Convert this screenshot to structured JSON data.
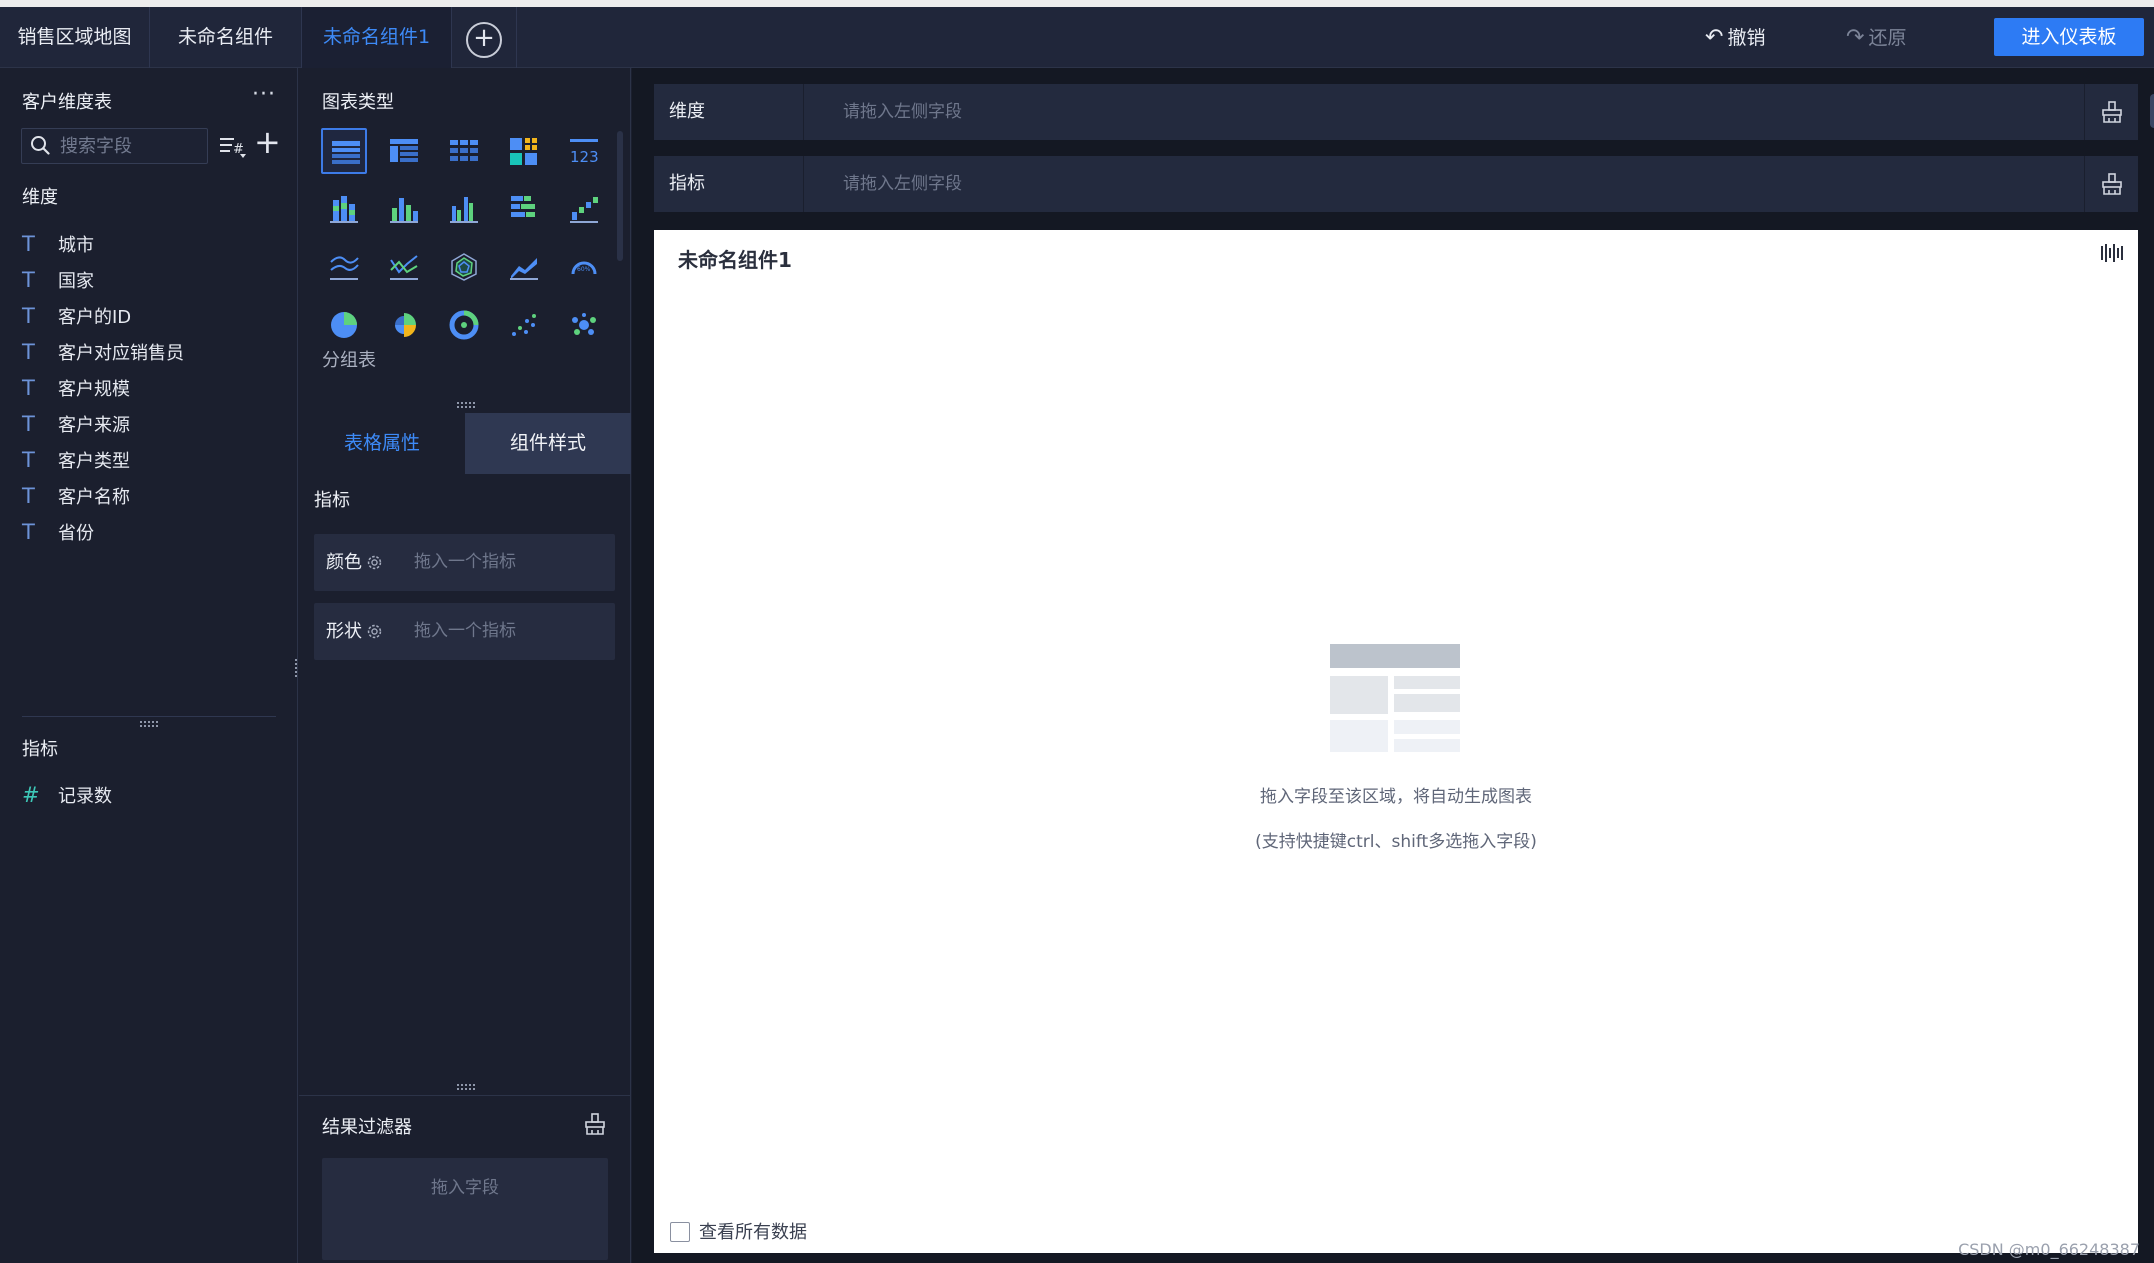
{
  "tabs": [
    {
      "label": "销售区域地图"
    },
    {
      "label": "未命名组件"
    },
    {
      "label": "未命名组件1"
    }
  ],
  "toolbar": {
    "undo_label": "撤销",
    "redo_label": "还原",
    "enter_dashboard_label": "进入仪表板"
  },
  "left_panel": {
    "table_title": "客户维度表",
    "more_glyph": "···",
    "search_placeholder": "搜索字段",
    "dimension_label": "维度",
    "dimensions": [
      "城市",
      "国家",
      "客户的ID",
      "客户对应销售员",
      "客户规模",
      "客户来源",
      "客户类型",
      "客户名称",
      "省份"
    ],
    "metric_label": "指标",
    "metrics": [
      "记录数"
    ]
  },
  "middle_panel": {
    "chart_type_title": "图表类型",
    "selected_chart_name": "分组表",
    "chart_type_icons": [
      "grouped-table-icon",
      "cross-table-icon",
      "detail-table-icon",
      "heatmap-table-icon",
      "kpi-number-icon",
      "stacked-bar-icon",
      "column-chart-icon",
      "grouped-column-icon",
      "horizontal-bar-icon",
      "waterfall-icon",
      "line-chart-icon",
      "combo-line-icon",
      "radar-chart-icon",
      "area-chart-icon",
      "gauge-icon",
      "pie-chart-icon",
      "rose-pie-icon",
      "ring-chart-icon",
      "scatter-icon",
      "bubble-icon"
    ],
    "prop_tabs": [
      "表格属性",
      "组件样式"
    ],
    "metric_label": "指标",
    "color_label": "颜色",
    "shape_label": "形状",
    "drop_metric_placeholder": "拖入一个指标",
    "result_filter_title": "结果过滤器",
    "drop_field_placeholder": "拖入字段"
  },
  "right_panel": {
    "dimension_shelf_label": "维度",
    "metric_shelf_label": "指标",
    "shelf_placeholder": "请拖入左侧字段",
    "component_title": "未命名组件1",
    "hint_line1": "拖入字段至该区域，将自动生成图表",
    "hint_line2": "(支持快捷键ctrl、shift多选拖入字段)",
    "view_all_label": "查看所有数据",
    "view_all_checked": false,
    "watermark": "CSDN @m0_66248387"
  },
  "colors": {
    "accent": "#2d7bf4",
    "active_tab_text": "#3d8af7",
    "background": "#1b1f2e"
  }
}
